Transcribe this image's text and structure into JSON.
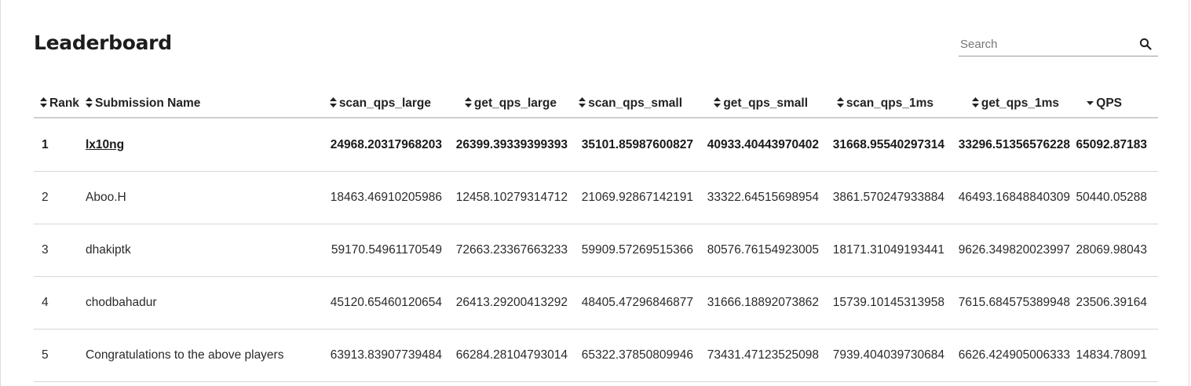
{
  "page": {
    "title": "Leaderboard"
  },
  "search": {
    "placeholder": "Search",
    "value": "",
    "icon": "search-icon"
  },
  "table": {
    "columns": [
      {
        "label": "Rank",
        "sort_icon": "sort-both-icon"
      },
      {
        "label": "Submission Name",
        "sort_icon": "sort-both-icon"
      },
      {
        "label": "scan_qps_large",
        "sort_icon": "sort-both-icon"
      },
      {
        "label": "get_qps_large",
        "sort_icon": "sort-both-icon"
      },
      {
        "label": "scan_qps_small",
        "sort_icon": "sort-both-icon"
      },
      {
        "label": "get_qps_small",
        "sort_icon": "sort-both-icon"
      },
      {
        "label": "scan_qps_1ms",
        "sort_icon": "sort-both-icon"
      },
      {
        "label": "get_qps_1ms",
        "sort_icon": "sort-both-icon"
      },
      {
        "label": "QPS",
        "sort_icon": "sort-desc-icon"
      }
    ],
    "rows": [
      {
        "rank": "1",
        "name": "lx10ng",
        "scan_qps_large": "24968.20317968203",
        "get_qps_large": "26399.39339399393",
        "scan_qps_small": "35101.85987600827",
        "get_qps_small": "40933.40443970402",
        "scan_qps_1ms": "31668.95540297314",
        "get_qps_1ms": "33296.51356576228",
        "qps": "65092.87183"
      },
      {
        "rank": "2",
        "name": "Aboo.H",
        "scan_qps_large": "18463.46910205986",
        "get_qps_large": "12458.10279314712",
        "scan_qps_small": "21069.92867142191",
        "get_qps_small": "33322.64515698954",
        "scan_qps_1ms": "3861.570247933884",
        "get_qps_1ms": "46493.16848840309",
        "qps": "50440.05288"
      },
      {
        "rank": "3",
        "name": "dhakiptk",
        "scan_qps_large": "59170.54961170549",
        "get_qps_large": "72663.23367663233",
        "scan_qps_small": "59909.57269515366",
        "get_qps_small": "80576.76154923005",
        "scan_qps_1ms": "18171.31049193441",
        "get_qps_1ms": "9626.349820023997",
        "qps": "28069.98043"
      },
      {
        "rank": "4",
        "name": "chodbahadur",
        "scan_qps_large": "45120.65460120654",
        "get_qps_large": "26413.29200413292",
        "scan_qps_small": "48405.47296846877",
        "get_qps_small": "31666.18892073862",
        "scan_qps_1ms": "15739.10145313958",
        "get_qps_1ms": "7615.684575389948",
        "qps": "23506.39164"
      },
      {
        "rank": "5",
        "name": "Congratulations to the above players",
        "scan_qps_large": "63913.83907739484",
        "get_qps_large": "66284.28104793014",
        "scan_qps_small": "65322.37850809946",
        "get_qps_small": "73431.47123525098",
        "scan_qps_1ms": "7939.404039730684",
        "get_qps_1ms": "6626.424905006333",
        "qps": "14834.78091"
      }
    ]
  }
}
